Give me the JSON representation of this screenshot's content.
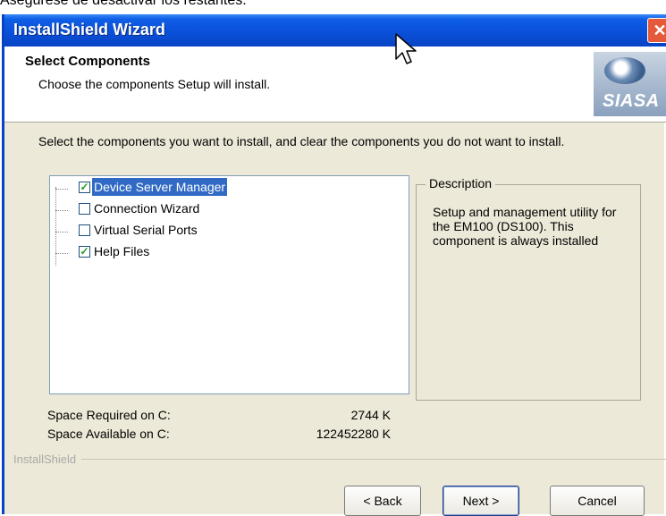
{
  "caption": "Asegúrese de desactivar los restantes.",
  "window": {
    "title": "InstallShield Wizard",
    "close_glyph": "✕"
  },
  "header": {
    "title": "Select Components",
    "subtitle": "Choose the components Setup will install.",
    "logo_text": "SIASA"
  },
  "instructions": "Select the components you want to install, and clear the components you do not want to install.",
  "components": [
    {
      "label": "Device Server Manager",
      "checked": true,
      "selected": true
    },
    {
      "label": "Connection Wizard",
      "checked": false,
      "selected": false
    },
    {
      "label": "Virtual Serial Ports",
      "checked": false,
      "selected": false
    },
    {
      "label": "Help Files",
      "checked": true,
      "selected": false
    }
  ],
  "description": {
    "legend": "Description",
    "text": "Setup and management utility for the EM100 (DS100). This component is always installed"
  },
  "space": {
    "required_label": "Space Required on  C:",
    "required_value": "2744 K",
    "available_label": "Space Available on  C:",
    "available_value": "122452280 K"
  },
  "footer": {
    "brand": "InstallShield"
  },
  "buttons": {
    "back": "< Back",
    "next": "Next >",
    "cancel": "Cancel"
  },
  "colors": {
    "title_bar": "#0a4fd8",
    "selection": "#316ac5",
    "close": "#e45a3a"
  }
}
